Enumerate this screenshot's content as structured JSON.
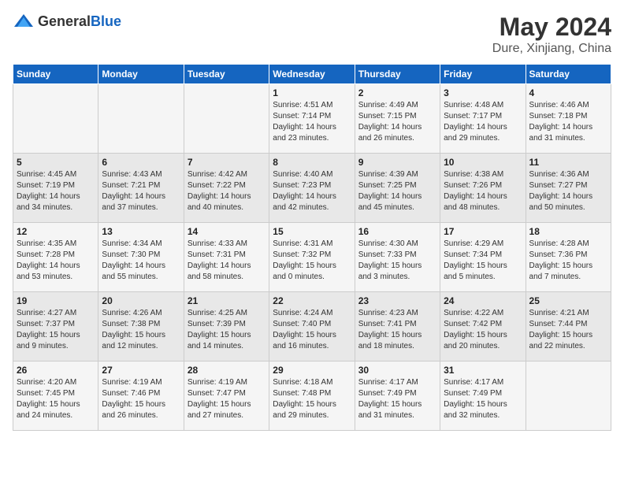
{
  "logo": {
    "general": "General",
    "blue": "Blue"
  },
  "header": {
    "month_year": "May 2024",
    "location": "Dure, Xinjiang, China"
  },
  "weekdays": [
    "Sunday",
    "Monday",
    "Tuesday",
    "Wednesday",
    "Thursday",
    "Friday",
    "Saturday"
  ],
  "weeks": [
    [
      {
        "day": "",
        "sunrise": "",
        "sunset": "",
        "daylight": ""
      },
      {
        "day": "",
        "sunrise": "",
        "sunset": "",
        "daylight": ""
      },
      {
        "day": "",
        "sunrise": "",
        "sunset": "",
        "daylight": ""
      },
      {
        "day": "1",
        "sunrise": "Sunrise: 4:51 AM",
        "sunset": "Sunset: 7:14 PM",
        "daylight": "Daylight: 14 hours and 23 minutes."
      },
      {
        "day": "2",
        "sunrise": "Sunrise: 4:49 AM",
        "sunset": "Sunset: 7:15 PM",
        "daylight": "Daylight: 14 hours and 26 minutes."
      },
      {
        "day": "3",
        "sunrise": "Sunrise: 4:48 AM",
        "sunset": "Sunset: 7:17 PM",
        "daylight": "Daylight: 14 hours and 29 minutes."
      },
      {
        "day": "4",
        "sunrise": "Sunrise: 4:46 AM",
        "sunset": "Sunset: 7:18 PM",
        "daylight": "Daylight: 14 hours and 31 minutes."
      }
    ],
    [
      {
        "day": "5",
        "sunrise": "Sunrise: 4:45 AM",
        "sunset": "Sunset: 7:19 PM",
        "daylight": "Daylight: 14 hours and 34 minutes."
      },
      {
        "day": "6",
        "sunrise": "Sunrise: 4:43 AM",
        "sunset": "Sunset: 7:21 PM",
        "daylight": "Daylight: 14 hours and 37 minutes."
      },
      {
        "day": "7",
        "sunrise": "Sunrise: 4:42 AM",
        "sunset": "Sunset: 7:22 PM",
        "daylight": "Daylight: 14 hours and 40 minutes."
      },
      {
        "day": "8",
        "sunrise": "Sunrise: 4:40 AM",
        "sunset": "Sunset: 7:23 PM",
        "daylight": "Daylight: 14 hours and 42 minutes."
      },
      {
        "day": "9",
        "sunrise": "Sunrise: 4:39 AM",
        "sunset": "Sunset: 7:25 PM",
        "daylight": "Daylight: 14 hours and 45 minutes."
      },
      {
        "day": "10",
        "sunrise": "Sunrise: 4:38 AM",
        "sunset": "Sunset: 7:26 PM",
        "daylight": "Daylight: 14 hours and 48 minutes."
      },
      {
        "day": "11",
        "sunrise": "Sunrise: 4:36 AM",
        "sunset": "Sunset: 7:27 PM",
        "daylight": "Daylight: 14 hours and 50 minutes."
      }
    ],
    [
      {
        "day": "12",
        "sunrise": "Sunrise: 4:35 AM",
        "sunset": "Sunset: 7:28 PM",
        "daylight": "Daylight: 14 hours and 53 minutes."
      },
      {
        "day": "13",
        "sunrise": "Sunrise: 4:34 AM",
        "sunset": "Sunset: 7:30 PM",
        "daylight": "Daylight: 14 hours and 55 minutes."
      },
      {
        "day": "14",
        "sunrise": "Sunrise: 4:33 AM",
        "sunset": "Sunset: 7:31 PM",
        "daylight": "Daylight: 14 hours and 58 minutes."
      },
      {
        "day": "15",
        "sunrise": "Sunrise: 4:31 AM",
        "sunset": "Sunset: 7:32 PM",
        "daylight": "Daylight: 15 hours and 0 minutes."
      },
      {
        "day": "16",
        "sunrise": "Sunrise: 4:30 AM",
        "sunset": "Sunset: 7:33 PM",
        "daylight": "Daylight: 15 hours and 3 minutes."
      },
      {
        "day": "17",
        "sunrise": "Sunrise: 4:29 AM",
        "sunset": "Sunset: 7:34 PM",
        "daylight": "Daylight: 15 hours and 5 minutes."
      },
      {
        "day": "18",
        "sunrise": "Sunrise: 4:28 AM",
        "sunset": "Sunset: 7:36 PM",
        "daylight": "Daylight: 15 hours and 7 minutes."
      }
    ],
    [
      {
        "day": "19",
        "sunrise": "Sunrise: 4:27 AM",
        "sunset": "Sunset: 7:37 PM",
        "daylight": "Daylight: 15 hours and 9 minutes."
      },
      {
        "day": "20",
        "sunrise": "Sunrise: 4:26 AM",
        "sunset": "Sunset: 7:38 PM",
        "daylight": "Daylight: 15 hours and 12 minutes."
      },
      {
        "day": "21",
        "sunrise": "Sunrise: 4:25 AM",
        "sunset": "Sunset: 7:39 PM",
        "daylight": "Daylight: 15 hours and 14 minutes."
      },
      {
        "day": "22",
        "sunrise": "Sunrise: 4:24 AM",
        "sunset": "Sunset: 7:40 PM",
        "daylight": "Daylight: 15 hours and 16 minutes."
      },
      {
        "day": "23",
        "sunrise": "Sunrise: 4:23 AM",
        "sunset": "Sunset: 7:41 PM",
        "daylight": "Daylight: 15 hours and 18 minutes."
      },
      {
        "day": "24",
        "sunrise": "Sunrise: 4:22 AM",
        "sunset": "Sunset: 7:42 PM",
        "daylight": "Daylight: 15 hours and 20 minutes."
      },
      {
        "day": "25",
        "sunrise": "Sunrise: 4:21 AM",
        "sunset": "Sunset: 7:44 PM",
        "daylight": "Daylight: 15 hours and 22 minutes."
      }
    ],
    [
      {
        "day": "26",
        "sunrise": "Sunrise: 4:20 AM",
        "sunset": "Sunset: 7:45 PM",
        "daylight": "Daylight: 15 hours and 24 minutes."
      },
      {
        "day": "27",
        "sunrise": "Sunrise: 4:19 AM",
        "sunset": "Sunset: 7:46 PM",
        "daylight": "Daylight: 15 hours and 26 minutes."
      },
      {
        "day": "28",
        "sunrise": "Sunrise: 4:19 AM",
        "sunset": "Sunset: 7:47 PM",
        "daylight": "Daylight: 15 hours and 27 minutes."
      },
      {
        "day": "29",
        "sunrise": "Sunrise: 4:18 AM",
        "sunset": "Sunset: 7:48 PM",
        "daylight": "Daylight: 15 hours and 29 minutes."
      },
      {
        "day": "30",
        "sunrise": "Sunrise: 4:17 AM",
        "sunset": "Sunset: 7:49 PM",
        "daylight": "Daylight: 15 hours and 31 minutes."
      },
      {
        "day": "31",
        "sunrise": "Sunrise: 4:17 AM",
        "sunset": "Sunset: 7:49 PM",
        "daylight": "Daylight: 15 hours and 32 minutes."
      },
      {
        "day": "",
        "sunrise": "",
        "sunset": "",
        "daylight": ""
      }
    ]
  ]
}
